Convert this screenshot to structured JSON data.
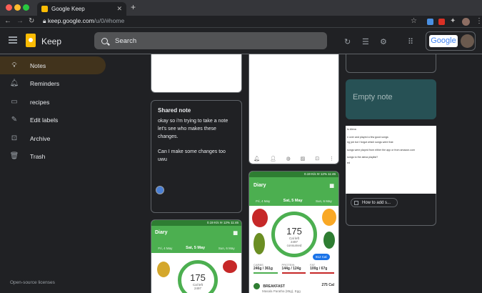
{
  "browser": {
    "tab_title": "Google Keep",
    "tab_close": "✕",
    "new_tab": "+",
    "url_host": "keep.google.com",
    "url_path": "/u/0/#home"
  },
  "header": {
    "app_name": "Keep",
    "search_placeholder": "Search",
    "google_word": "Google"
  },
  "sidebar": {
    "items": [
      {
        "label": "Notes"
      },
      {
        "label": "Reminders"
      },
      {
        "label": "recipes"
      },
      {
        "label": "Edit labels"
      },
      {
        "label": "Archive"
      },
      {
        "label": "Trash"
      }
    ],
    "license": "Open-source licenses"
  },
  "notes": {
    "shared": {
      "title": "Shared note",
      "body1": "okay so i'm trying to take a note let's see who makes these changes.",
      "body2": "Can I make some changes too uwu"
    },
    "empty": {
      "title": "Empty note"
    },
    "alexa": {
      "lines": [
        "to Alexa",
        "n over and played a few good songs",
        "ng job but I forgot which songs were that",
        "songs were played from either the app or from amazon.com",
        "songs to the alexa playlist?",
        "ed"
      ],
      "link_label": "How to add s..."
    },
    "diary1": {
      "status": "0.19 K/s ✉ 12% 11:46",
      "title": "Diary",
      "day_prev": "Fri, 4 May",
      "day_cur": "Sat, 5 May",
      "day_next": "Sun, 6 May",
      "cal_value": "175",
      "cal_label": "Cal left",
      "goal": "2497",
      "goal_label": "consumed",
      "badge": "812 Cal",
      "macros": [
        {
          "name": "CARBS",
          "value": "246g",
          "sub": "/ 361g"
        },
        {
          "name": "PROTEIN",
          "value": "144g",
          "sub": "/ 124g"
        },
        {
          "name": "FAT",
          "value": "100g",
          "sub": "/ 67g"
        }
      ],
      "meal": "BREAKFAST",
      "meal_cal": "275 Cal",
      "meal_item": "Masala Paratha (85g), Egg"
    },
    "diary2": {
      "status": "0.19 K/s ✉ 12% 11:46",
      "title": "Diary",
      "day_prev": "Fri, 4 May",
      "day_cur": "Sat, 5 May",
      "day_next": "Sun, 6 May",
      "cal_value": "175",
      "cal_label": "Cal left",
      "goal": "2497"
    }
  },
  "colors": {
    "background": "#202124",
    "active_nav": "#41331c",
    "empty_note": "#275155",
    "keep_yellow": "#fbbc04",
    "diary_green": "#4caf50"
  }
}
